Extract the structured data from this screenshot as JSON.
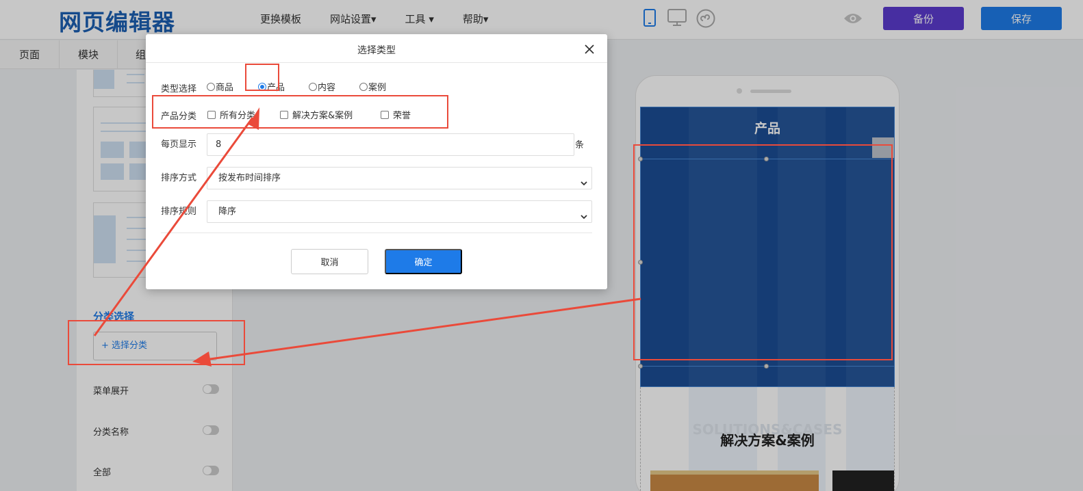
{
  "header": {
    "logo": "网页编辑器",
    "nav": [
      "更换模板",
      "网站设置▾",
      "工具 ▾",
      "帮助▾"
    ],
    "backup_label": "备份",
    "save_label": "保存",
    "colors": {
      "backup": "#5b3ccf",
      "save": "#1e7be8",
      "logo": "#1b5fb3"
    }
  },
  "left_tabs": [
    "页面",
    "模块",
    "组"
  ],
  "left_panel": {
    "section_title": "分类选择",
    "select_button": "+ 选择分类",
    "options": [
      {
        "label": "菜单展开",
        "on": false
      },
      {
        "label": "分类名称",
        "on": false
      },
      {
        "label": "全部",
        "on": false
      }
    ]
  },
  "preview": {
    "top_title": "产品",
    "section_en": "SOLUTIONS&CASES",
    "section_cn": "解决方案&案例"
  },
  "dialog": {
    "title": "选择类型",
    "type_label": "类型选择",
    "types": [
      {
        "label": "商品",
        "checked": false
      },
      {
        "label": "产品",
        "checked": true
      },
      {
        "label": "内容",
        "checked": false
      },
      {
        "label": "案例",
        "checked": false
      }
    ],
    "category_label": "产品分类",
    "categories": [
      "所有分类",
      "解决方案&案例",
      "荣誉"
    ],
    "per_page_label": "每页显示",
    "per_page_value": "8",
    "per_page_unit": "条",
    "sort_label": "排序方式",
    "sort_value": "按发布时间排序",
    "order_label": "排序规则",
    "order_value": "降序",
    "cancel_label": "取消",
    "ok_label": "确定"
  }
}
